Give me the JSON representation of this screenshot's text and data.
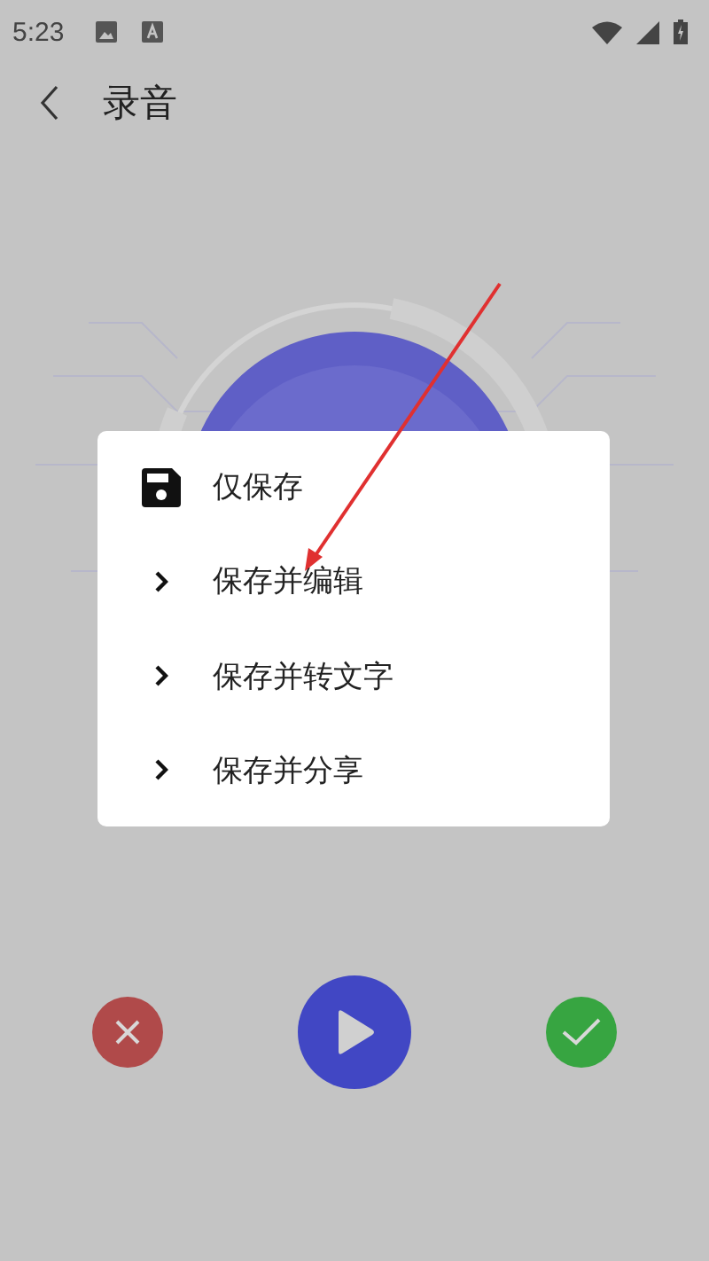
{
  "status_bar": {
    "time": "5:23"
  },
  "toolbar": {
    "title": "录音"
  },
  "menu": {
    "items": [
      {
        "label": "仅保存",
        "kind": "save"
      },
      {
        "label": "保存并编辑",
        "kind": "more"
      },
      {
        "label": "保存并转文字",
        "kind": "more"
      },
      {
        "label": "保存并分享",
        "kind": "more"
      }
    ]
  },
  "controls": [
    {
      "kind": "discard"
    },
    {
      "kind": "play"
    },
    {
      "kind": "confirm"
    }
  ]
}
